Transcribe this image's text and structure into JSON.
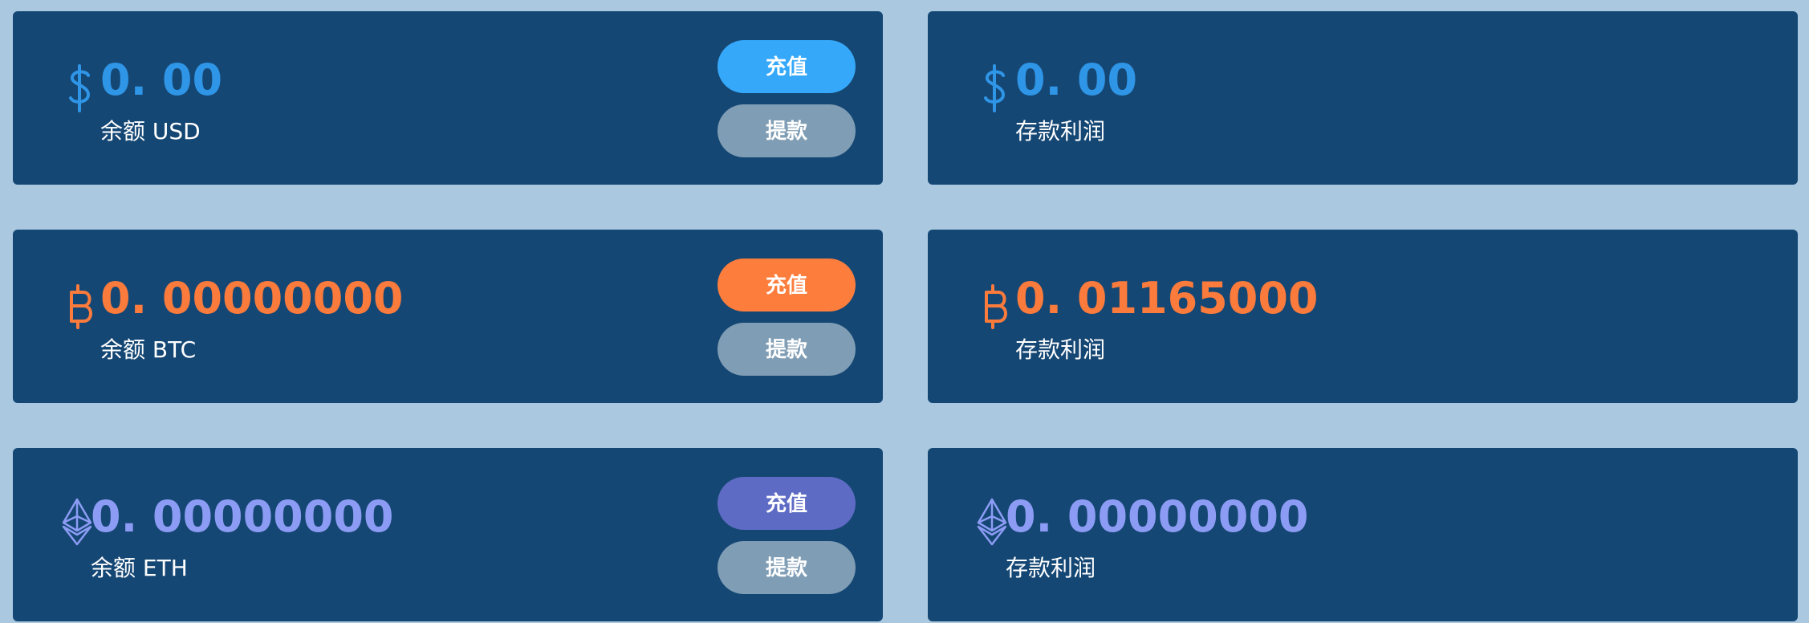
{
  "colors": {
    "page_bg": "#aac8e0",
    "card_bg": "#154774",
    "usd_accent": "#2f95e6",
    "btc_accent": "#fb7b3c",
    "eth_accent": "#8c9cf5",
    "usd_button": "#35a8f9",
    "btc_button": "#fd7d3d",
    "eth_button": "#5e6bc4",
    "withdraw_button": "#7f9db4"
  },
  "balances": [
    {
      "currency": "USD",
      "icon": "dollar-icon",
      "amount": "0. 00",
      "caption": "余额 USD",
      "deposit_label": "充值",
      "withdraw_label": "提款"
    },
    {
      "currency": "BTC",
      "icon": "bitcoin-icon",
      "amount": "0. 00000000",
      "caption": "余额 BTC",
      "deposit_label": "充值",
      "withdraw_label": "提款"
    },
    {
      "currency": "ETH",
      "icon": "ethereum-icon",
      "amount": "0. 00000000",
      "caption": "余额 ETH",
      "deposit_label": "充值",
      "withdraw_label": "提款"
    }
  ],
  "profits": [
    {
      "currency": "USD",
      "icon": "dollar-icon",
      "amount": "0. 00",
      "caption": "存款利润"
    },
    {
      "currency": "BTC",
      "icon": "bitcoin-icon",
      "amount": "0. 01165000",
      "caption": "存款利润"
    },
    {
      "currency": "ETH",
      "icon": "ethereum-icon",
      "amount": "0. 00000000",
      "caption": "存款利润"
    }
  ]
}
